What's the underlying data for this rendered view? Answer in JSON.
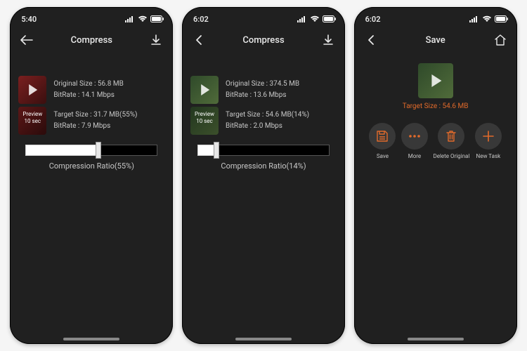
{
  "screens": [
    {
      "status": {
        "time": "5:40"
      },
      "nav": {
        "title": "Compress",
        "back": "back",
        "rightIcon": "download"
      },
      "thumbStyle": "red",
      "original": {
        "label_size": "Original Size : 56.8 MB",
        "label_bitrate": "BitRate : 14.1 Mbps"
      },
      "preview": {
        "overlay_line1": "Preview",
        "overlay_line2": "10 sec"
      },
      "target": {
        "label_size": "Target Size : 31.7 MB(55%)",
        "label_bitrate": "BitRate : 7.9 Mbps"
      },
      "slider": {
        "ratio_label": "Compression Ratio(55%)",
        "percent": 55
      }
    },
    {
      "status": {
        "time": "6:02"
      },
      "nav": {
        "title": "Compress",
        "back": "back",
        "rightIcon": "download"
      },
      "thumbStyle": "green",
      "original": {
        "label_size": "Original Size : 374.5 MB",
        "label_bitrate": "BitRate : 13.6 Mbps"
      },
      "preview": {
        "overlay_line1": "Preview",
        "overlay_line2": "10 sec"
      },
      "target": {
        "label_size": "Target Size : 54.6 MB(14%)",
        "label_bitrate": "BitRate : 2.0 Mbps"
      },
      "slider": {
        "ratio_label": "Compression Ratio(14%)",
        "percent": 14
      }
    },
    {
      "status": {
        "time": "6:02"
      },
      "nav": {
        "title": "Save",
        "back": "back",
        "rightIcon": "home"
      },
      "thumbStyle": "green",
      "save_target_label": "Target Size : 54.6 MB",
      "actions": [
        {
          "name": "save",
          "label": "Save",
          "icon": "save"
        },
        {
          "name": "more",
          "label": "More",
          "icon": "dots"
        },
        {
          "name": "delete",
          "label": "Delete Original",
          "icon": "trash"
        },
        {
          "name": "newtask",
          "label": "New Task",
          "icon": "plus"
        }
      ]
    }
  ]
}
